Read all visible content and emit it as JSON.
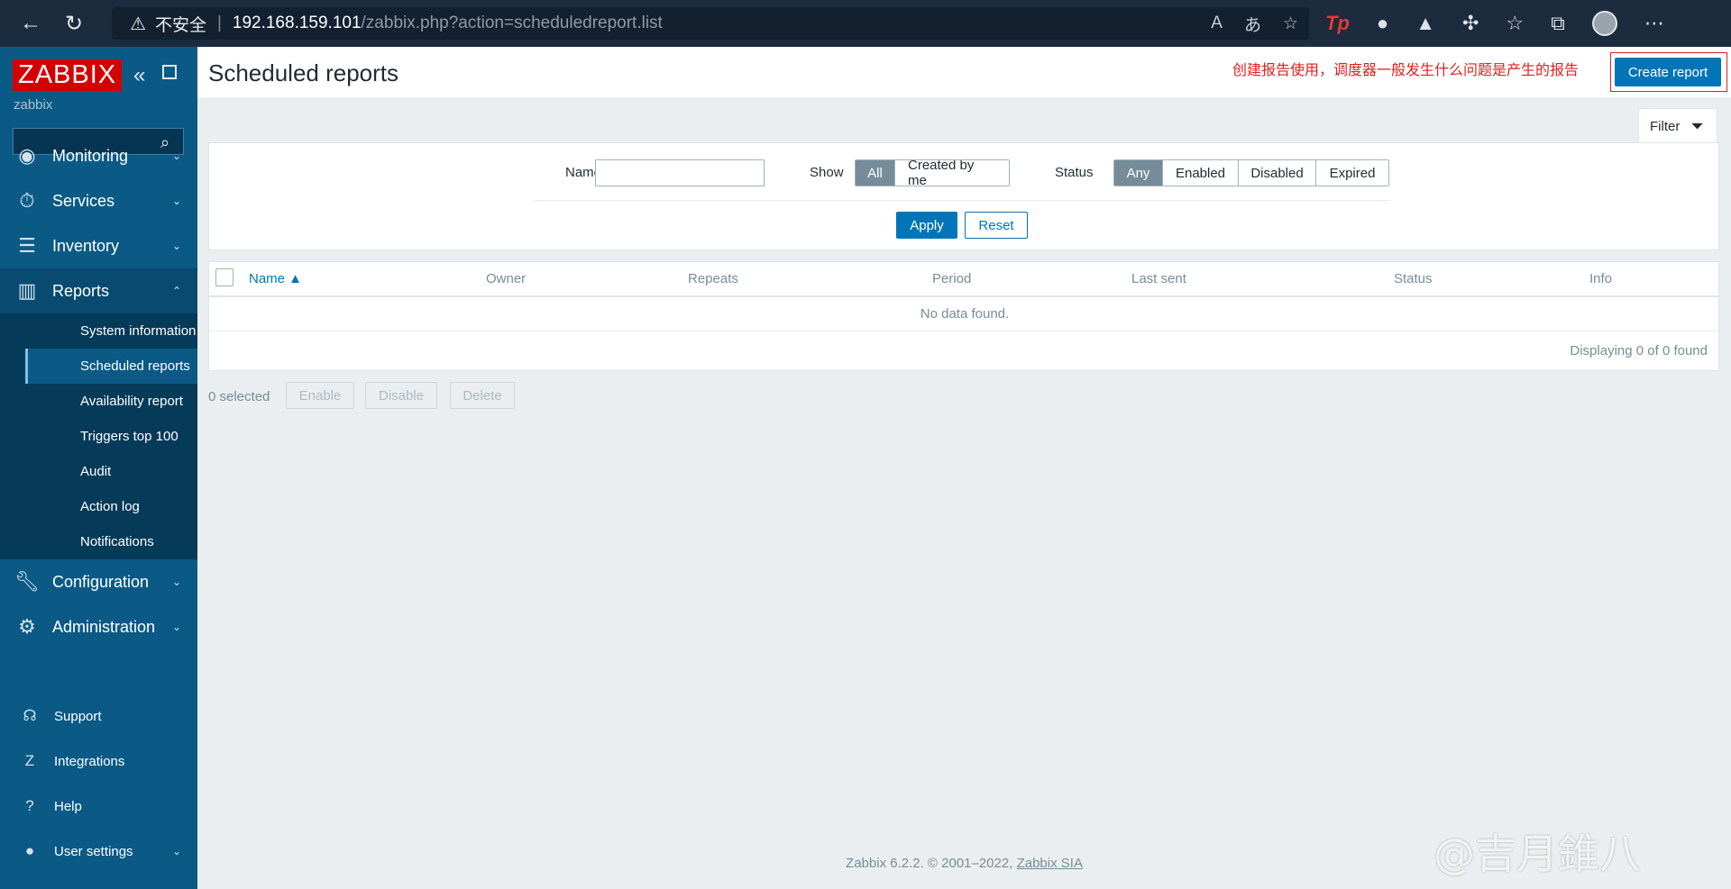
{
  "browser": {
    "security_warning": "不安全",
    "url_host": "192.168.159.101",
    "url_path": "/zabbix.php?action=scheduledreport.list"
  },
  "sidebar": {
    "logo": "ZABBIX",
    "server_name": "zabbix",
    "search_placeholder": "",
    "menu": [
      {
        "label": "Monitoring",
        "icon": "eye-icon"
      },
      {
        "label": "Services",
        "icon": "stopwatch-icon"
      },
      {
        "label": "Inventory",
        "icon": "list-icon"
      },
      {
        "label": "Reports",
        "icon": "chart-icon"
      }
    ],
    "reports_sub": [
      {
        "label": "System information"
      },
      {
        "label": "Scheduled reports"
      },
      {
        "label": "Availability report"
      },
      {
        "label": "Triggers top 100"
      },
      {
        "label": "Audit"
      },
      {
        "label": "Action log"
      },
      {
        "label": "Notifications"
      }
    ],
    "menu2": [
      {
        "label": "Configuration",
        "icon": "wrench-icon"
      },
      {
        "label": "Administration",
        "icon": "gear-icon"
      }
    ],
    "bottom": [
      {
        "label": "Support"
      },
      {
        "label": "Integrations"
      },
      {
        "label": "Help"
      },
      {
        "label": "User settings"
      }
    ]
  },
  "header": {
    "title": "Scheduled reports",
    "annotation": "创建报告使用，调度器一般发生什么问题是产生的报告",
    "create_button": "Create report"
  },
  "filter": {
    "tab_label": "Filter",
    "name_label": "Name",
    "name_value": "",
    "show_label": "Show",
    "show_options": [
      "All",
      "Created by me"
    ],
    "show_selected": "All",
    "status_label": "Status",
    "status_options": [
      "Any",
      "Enabled",
      "Disabled",
      "Expired"
    ],
    "status_selected": "Any",
    "apply": "Apply",
    "reset": "Reset"
  },
  "table": {
    "columns": [
      "Name ▲",
      "Owner",
      "Repeats",
      "Period",
      "Last sent",
      "Status",
      "Info"
    ],
    "empty_text": "No data found.",
    "displaying": "Displaying 0 of 0 found"
  },
  "actions": {
    "selected": "0 selected",
    "enable": "Enable",
    "disable": "Disable",
    "delete": "Delete"
  },
  "footer": {
    "text": "Zabbix 6.2.2. © 2001–2022, ",
    "link": "Zabbix SIA"
  },
  "watermark": "@吉月錐八"
}
